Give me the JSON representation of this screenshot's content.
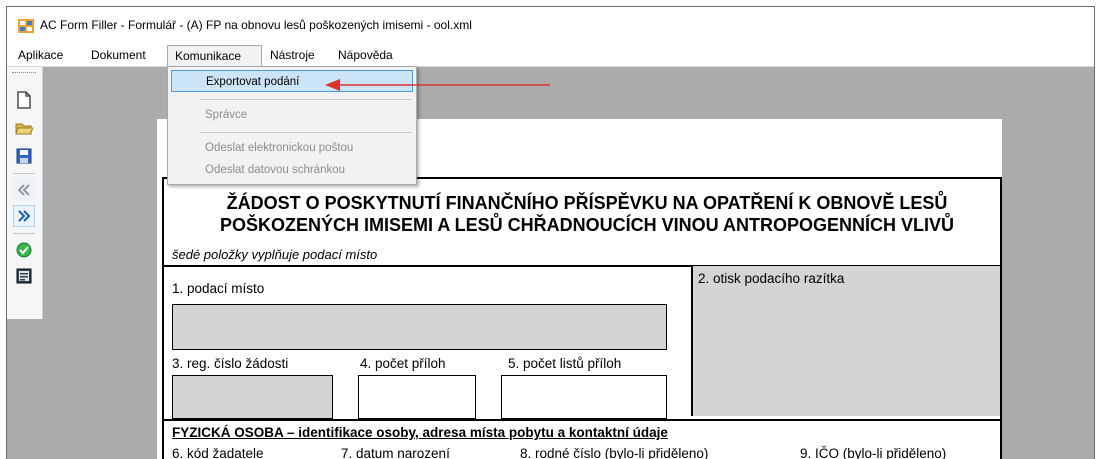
{
  "window": {
    "title": "AC Form Filler - Formulář - (A) FP na obnovu lesů poškozených imisemi - ool.xml",
    "icon": "app-form-icon"
  },
  "menubar": {
    "items": [
      {
        "label": "Aplikace"
      },
      {
        "label": "Dokument"
      },
      {
        "label": "Komunikace"
      },
      {
        "label": "Nástroje"
      },
      {
        "label": "Nápověda"
      }
    ],
    "open_menu": "Komunikace"
  },
  "dropdown": {
    "items": [
      {
        "label": "Exportovat podání",
        "enabled": true,
        "highlighted": true
      },
      {
        "label": "Správce",
        "enabled": false
      },
      {
        "label": "Odeslat elektronickou poštou",
        "enabled": false
      },
      {
        "label": "Odeslat datovou schránkou",
        "enabled": false
      }
    ]
  },
  "toolbar": {
    "buttons": [
      "new-document-icon",
      "open-folder-icon",
      "save-disk-icon",
      "previous-icon",
      "next-icon",
      "check-icon",
      "form-view-icon"
    ]
  },
  "form": {
    "title": "ŽÁDOST O POSKYTNUTÍ FINANČNÍHO PŘÍSPĚVKU NA OPATŘENÍ K OBNOVĚ LESŮ POŠKOZENÝCH IMISEMI A LESŮ CHŘADNOUCÍCH VINOU ANTROPOGENNÍCH VLIVŮ",
    "note": "šedé položky vyplňuje podací místo",
    "fields": {
      "f1": "1. podací místo",
      "f2": "2. otisk podacího razítka",
      "f3": "3. reg. číslo žádosti",
      "f4": "4. počet příloh",
      "f5": "5. počet listů příloh"
    },
    "section_heading": "FYZICKÁ OSOBA – identifikace osoby, adresa místa pobytu a kontaktní údaje",
    "row6": {
      "f6": "6. kód žadatele",
      "f7": "7. datum narození",
      "f8": "8. rodné číslo (bylo-li přiděleno)",
      "f9": "9. IČO (bylo-li přiděleno)"
    }
  },
  "colors": {
    "highlight_bg": "#cce4f7",
    "highlight_border": "#4a9be0",
    "annotation_arrow": "#e0322c",
    "gray_field": "#d4d4d4",
    "workspace": "#ababab"
  }
}
